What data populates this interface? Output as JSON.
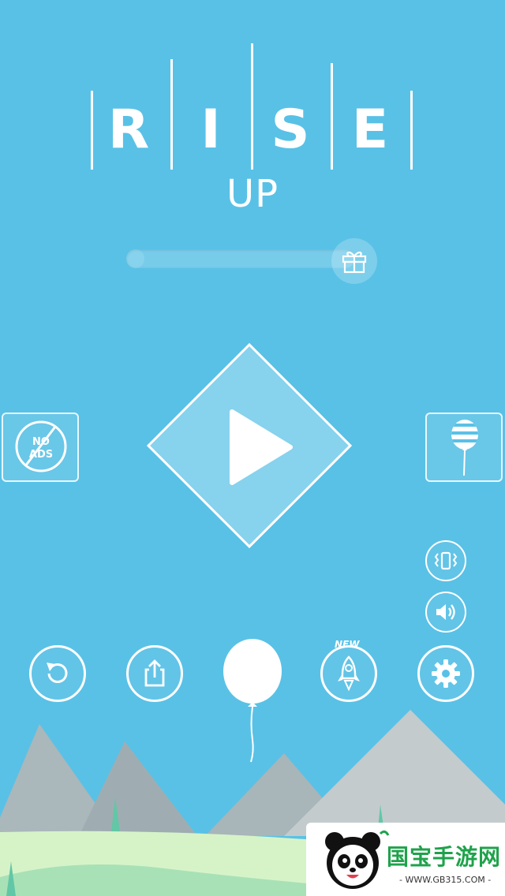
{
  "colors": {
    "background": "#59c1e6",
    "mountain_light": "#b3bfc2",
    "mountain_dark": "#93a2a8",
    "grass": "#d4f2c4",
    "grass_dark": "#a8e0b6",
    "tree": "#6fcfb0",
    "watermark_green": "#1fa24b"
  },
  "title": {
    "letters": [
      "R",
      "I",
      "S",
      "E"
    ],
    "subtitle": "UP"
  },
  "progress": {
    "fraction": 0.08,
    "reward_icon": "gift-icon"
  },
  "buttons": {
    "play_icon": "play-icon",
    "no_ads": {
      "line1": "NO",
      "line2": "ADS"
    },
    "balloon_skins_icon": "striped-balloon-icon",
    "vibration_icon": "vibration-icon",
    "sound_icon": "speaker-icon",
    "restart_icon": "restart-icon",
    "share_icon": "share-icon",
    "rocket_badge": "NEW",
    "settings_icon": "gear-icon"
  },
  "watermark": {
    "brand": "国宝手游网",
    "url": "- WWW.GB315.COM -"
  }
}
